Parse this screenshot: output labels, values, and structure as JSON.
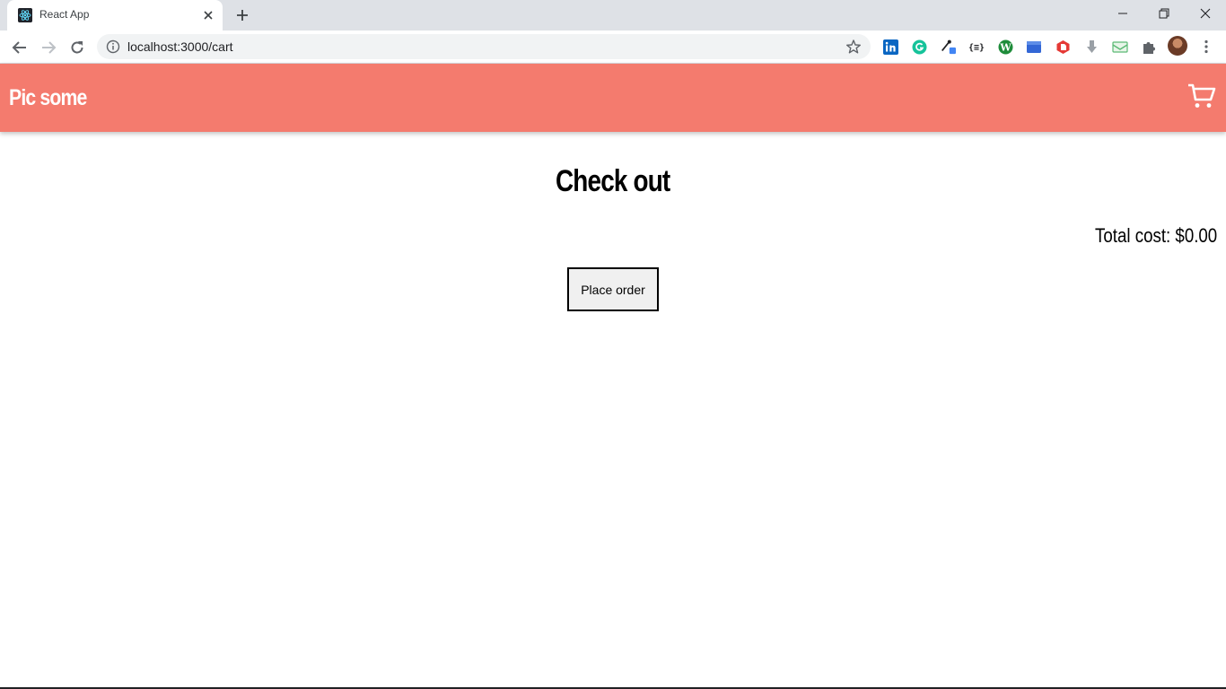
{
  "browser": {
    "tab_title": "React App",
    "url": "localhost:3000/cart",
    "extensions": [
      "linkedin-icon",
      "grammarly-icon",
      "eyedropper-icon",
      "json-icon",
      "wordpress-icon",
      "tab-manager-icon",
      "pdf-icon",
      "download-icon",
      "mail-icon",
      "puzzle-icon"
    ]
  },
  "header": {
    "logo": "Pic some",
    "background_color": "#f47b6e"
  },
  "main": {
    "title": "Check out",
    "total_cost": "Total cost: $0.00",
    "place_order_label": "Place order"
  }
}
